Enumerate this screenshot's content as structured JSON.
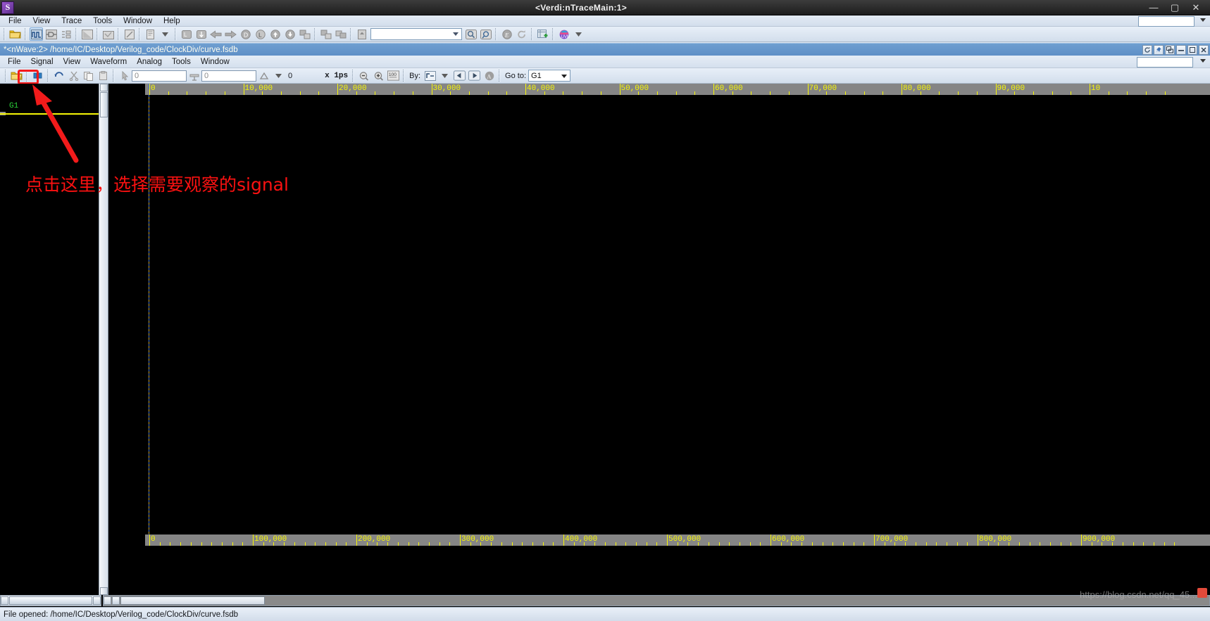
{
  "window": {
    "title": "<Verdi:nTraceMain:1>",
    "logo_text": "S",
    "minimize": "—",
    "maximize": "▢",
    "close": "✕"
  },
  "verdi_menu": {
    "items": [
      {
        "label": "File",
        "name": "menu-file"
      },
      {
        "label": "View",
        "name": "menu-view"
      },
      {
        "label": "Trace",
        "name": "menu-trace"
      },
      {
        "label": "Tools",
        "name": "menu-tools"
      },
      {
        "label": "Window",
        "name": "menu-window"
      },
      {
        "label": "Help",
        "name": "menu-help"
      }
    ]
  },
  "verdi_toolbar": {
    "combo_value": "",
    "icons": [
      "open-folder-icon",
      "waveform-icon",
      "schematic-icon",
      "connectivity-icon",
      "source-window-icon",
      "file-browser-icon",
      "edit-icon",
      "report-icon",
      "transcript-up-icon",
      "transcript-down-icon",
      "back-arrow-icon",
      "forward-arrow-icon",
      "driver-icon",
      "load-icon",
      "up-arrow-icon",
      "down-arrow-icon",
      "hierarchy-up-icon",
      "hierarchy-down-icon",
      "hierarchy-next-icon",
      "home-icon",
      "search-icon",
      "find-icon",
      "expression-icon",
      "refresh-icon",
      "new-window-icon",
      "uvm-icon"
    ]
  },
  "nwave": {
    "title_path": "*<nWave:2> /home/IC/Desktop/Verilog_code/ClockDiv/curve.fsdb",
    "window_controls": [
      "refresh-icon",
      "pin-icon",
      "undock-icon",
      "minimize-icon",
      "restore-icon",
      "close-icon"
    ],
    "menu": {
      "items": [
        {
          "label": "File",
          "name": "nwave-menu-file"
        },
        {
          "label": "Signal",
          "name": "nwave-menu-signal"
        },
        {
          "label": "View",
          "name": "nwave-menu-view"
        },
        {
          "label": "Waveform",
          "name": "nwave-menu-waveform"
        },
        {
          "label": "Analog",
          "name": "nwave-menu-analog"
        },
        {
          "label": "Tools",
          "name": "nwave-menu-tools"
        },
        {
          "label": "Window",
          "name": "nwave-menu-window"
        }
      ]
    },
    "toolbar": {
      "time_field_1": "0",
      "time_field_2": "0",
      "delta_value": "0",
      "unit_label": "x 1ps",
      "by_label": "By:",
      "goto_label": "Go to:",
      "goto_value": "G1",
      "zoom_all_label": "100",
      "icons": [
        "open-file-icon",
        "get-signals-icon",
        "undo-icon",
        "cut-icon",
        "copy-icon",
        "paste-icon",
        "pointer-icon",
        "marker-icon",
        "delta-icon",
        "zoom-out-icon",
        "zoom-in-icon",
        "zoom-fit-icon",
        "edge-icon",
        "prev-edge-icon",
        "next-edge-icon",
        "annotate-icon"
      ],
      "highlighted_icon": "get-signals-icon"
    }
  },
  "signal_pane": {
    "group_label": "G1",
    "signals": []
  },
  "ruler_top": {
    "unit": "ps",
    "labels": [
      "0",
      "10,000",
      "20,000",
      "30,000",
      "40,000",
      "50,000",
      "60,000",
      "70,000",
      "80,000",
      "90,000",
      "10"
    ]
  },
  "ruler_bottom": {
    "labels": [
      "0",
      "100,000",
      "200,000",
      "300,000",
      "400,000",
      "500,000",
      "600,000",
      "700,000",
      "800,000",
      "900,000"
    ]
  },
  "annotation": {
    "text": "点击这里，选择需要观察的signal",
    "color": "#fb1111",
    "arrow_color": "#f21b1b"
  },
  "statusbar": {
    "message": "File opened: /home/IC/Desktop/Verilog_code/ClockDiv/curve.fsdb"
  },
  "watermark": {
    "text": "https://blog.csdn.net/qq_45..."
  },
  "colors": {
    "accent": "#f5191a",
    "waveform_bg": "#000000",
    "ruler_bg": "#858585",
    "tick_yellow": "#f6f606",
    "group_green": "#2bd23a",
    "titlebar": "#1d1d1d"
  }
}
